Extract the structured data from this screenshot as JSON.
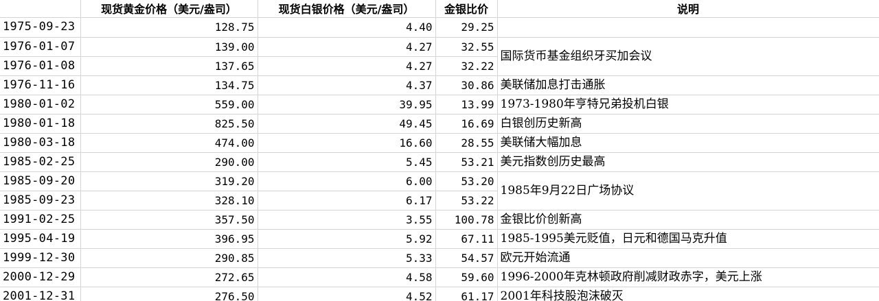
{
  "headers": {
    "date": "",
    "gold": "现货黄金价格（美元/盎司）",
    "silver": "现货白银价格（美元/盎司）",
    "ratio": "金银比价",
    "note": "说明"
  },
  "rows": [
    {
      "date": "1975-09-23",
      "gold": "128.75",
      "silver": "4.40",
      "ratio": "29.25",
      "note": ""
    },
    {
      "date": "1976-01-07",
      "gold": "139.00",
      "silver": "4.27",
      "ratio": "32.55",
      "note": "国际货币基金组织牙买加会议"
    },
    {
      "date": "1976-01-08",
      "gold": "137.65",
      "silver": "4.27",
      "ratio": "32.22"
    },
    {
      "date": "1976-11-16",
      "gold": "134.75",
      "silver": "4.37",
      "ratio": "30.86",
      "note": "美联储加息打击通胀"
    },
    {
      "date": "1980-01-02",
      "gold": "559.00",
      "silver": "39.95",
      "ratio": "13.99",
      "note": "1973-1980年亨特兄弟投机白银"
    },
    {
      "date": "1980-01-18",
      "gold": "825.50",
      "silver": "49.45",
      "ratio": "16.69",
      "note": "白银创历史新高"
    },
    {
      "date": "1980-03-18",
      "gold": "474.00",
      "silver": "16.60",
      "ratio": "28.55",
      "note": "美联储大幅加息"
    },
    {
      "date": "1985-02-25",
      "gold": "290.00",
      "silver": "5.45",
      "ratio": "53.21",
      "note": "美元指数创历史最高"
    },
    {
      "date": "1985-09-20",
      "gold": "319.20",
      "silver": "6.00",
      "ratio": "53.20",
      "note": "1985年9月22日广场协议"
    },
    {
      "date": "1985-09-23",
      "gold": "328.10",
      "silver": "6.17",
      "ratio": "53.22"
    },
    {
      "date": "1991-02-25",
      "gold": "357.50",
      "silver": "3.55",
      "ratio": "100.78",
      "note": "金银比价创新高"
    },
    {
      "date": "1995-04-19",
      "gold": "396.95",
      "silver": "5.92",
      "ratio": "67.11",
      "note": "1985-1995美元贬值，日元和德国马克升值"
    },
    {
      "date": "1999-12-30",
      "gold": "290.85",
      "silver": "5.33",
      "ratio": "54.57",
      "note": "欧元开始流通"
    },
    {
      "date": "2000-12-29",
      "gold": "272.65",
      "silver": "4.58",
      "ratio": "59.60",
      "note": "1996-2000年克林顿政府削减财政赤字，美元上涨"
    },
    {
      "date": "2001-12-31",
      "gold": "276.50",
      "silver": "4.52",
      "ratio": "61.17",
      "note": "2001年科技股泡沫破灭"
    }
  ]
}
